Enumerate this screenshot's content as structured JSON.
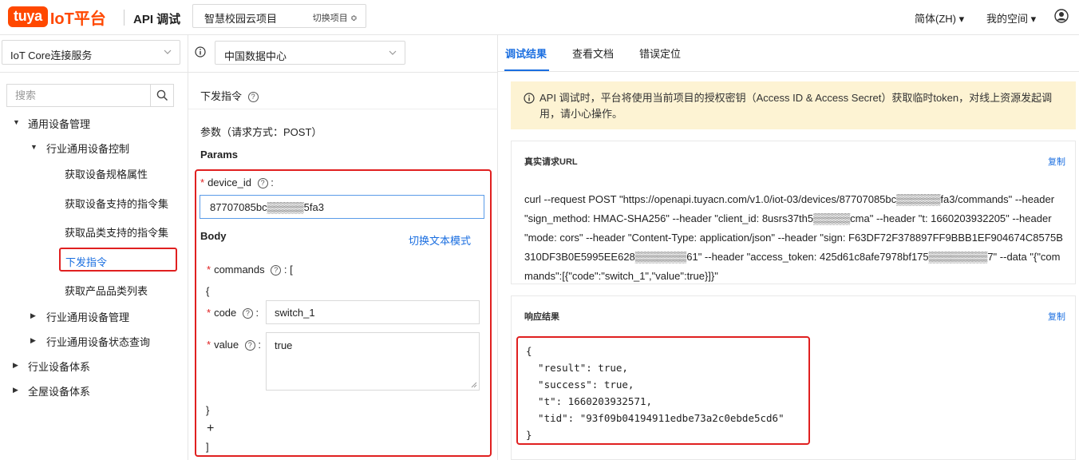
{
  "topbar": {
    "logo_badge": "tuya",
    "logo_text": "IoT平台",
    "page_title": "API 调试",
    "project_name": "智慧校园云项目",
    "project_switch": "切换项目 ≎",
    "language": "简体(ZH) ▾",
    "my_space": "我的空间 ▾"
  },
  "left": {
    "service_select": "IoT Core连接服务",
    "search_placeholder": "搜索",
    "tree": [
      "通用设备管理",
      "行业通用设备控制",
      "获取设备规格属性",
      "获取设备支持的指令集",
      "获取品类支持的指令集",
      "下发指令",
      "获取产品品类列表",
      "行业通用设备管理",
      "行业通用设备状态查询",
      "行业设备体系",
      "全屋设备体系"
    ]
  },
  "middle": {
    "datacenter": "中国数据中心",
    "title": "下发指令",
    "params_method": "参数（请求方式：POST）",
    "params_heading": "Params",
    "device_id_label": "device_id",
    "device_id_value": "87707085bc▒▒▒▒▒5fa3",
    "body_heading": "Body",
    "switch_text_mode": "切换文本模式",
    "commands_label": "commands",
    "code_label": "code",
    "code_value": "switch_1",
    "value_label": "value",
    "value_value": "true",
    "brackets": {
      "open_array": ":  [",
      "open_obj": "{",
      "close_obj": "}",
      "plus": "+",
      "close_array": "]"
    }
  },
  "right": {
    "tabs": [
      "调试结果",
      "查看文档",
      "错误定位"
    ],
    "notice": "API 调试时，平台将使用当前项目的授权密钥（Access ID & Access Secret）获取临时token，对线上资源发起调用，请小心操作。",
    "request_url_title": "真实请求URL",
    "copy_label": "复制",
    "curl": "curl --request POST \"https://openapi.tuyacn.com/v1.0/iot-03/devices/87707085bc▒▒▒▒▒▒fa3/commands\" --header \"sign_method: HMAC-SHA256\" --header \"client_id: 8usrs37th5▒▒▒▒▒cma\" --header \"t: 1660203932205\" --header \"mode: cors\" --header \"Content-Type: application/json\" --header \"sign: F63DF72F378897FF9BBB1EF904674C8575B310DF3B0E5995EE628▒▒▒▒▒▒▒61\" --header \"access_token: 425d61c8afe7978bf175▒▒▒▒▒▒▒▒7\" --data \"{\"commands\":[{\"code\":\"switch_1\",\"value\":true}]}\"",
    "response_title": "响应结果",
    "response_lines": [
      "{",
      "  \"result\": true,",
      "  \"success\": true,",
      "  \"t\": 1660203932571,",
      "  \"tid\": \"93f09b04194911edbe73a2c0ebde5cd6\"",
      "}"
    ]
  },
  "colors": {
    "accent": "#1a6ee0",
    "brand": "#ff4800",
    "highlight_border": "#e02020",
    "notice_bg": "#fdf3d3"
  }
}
